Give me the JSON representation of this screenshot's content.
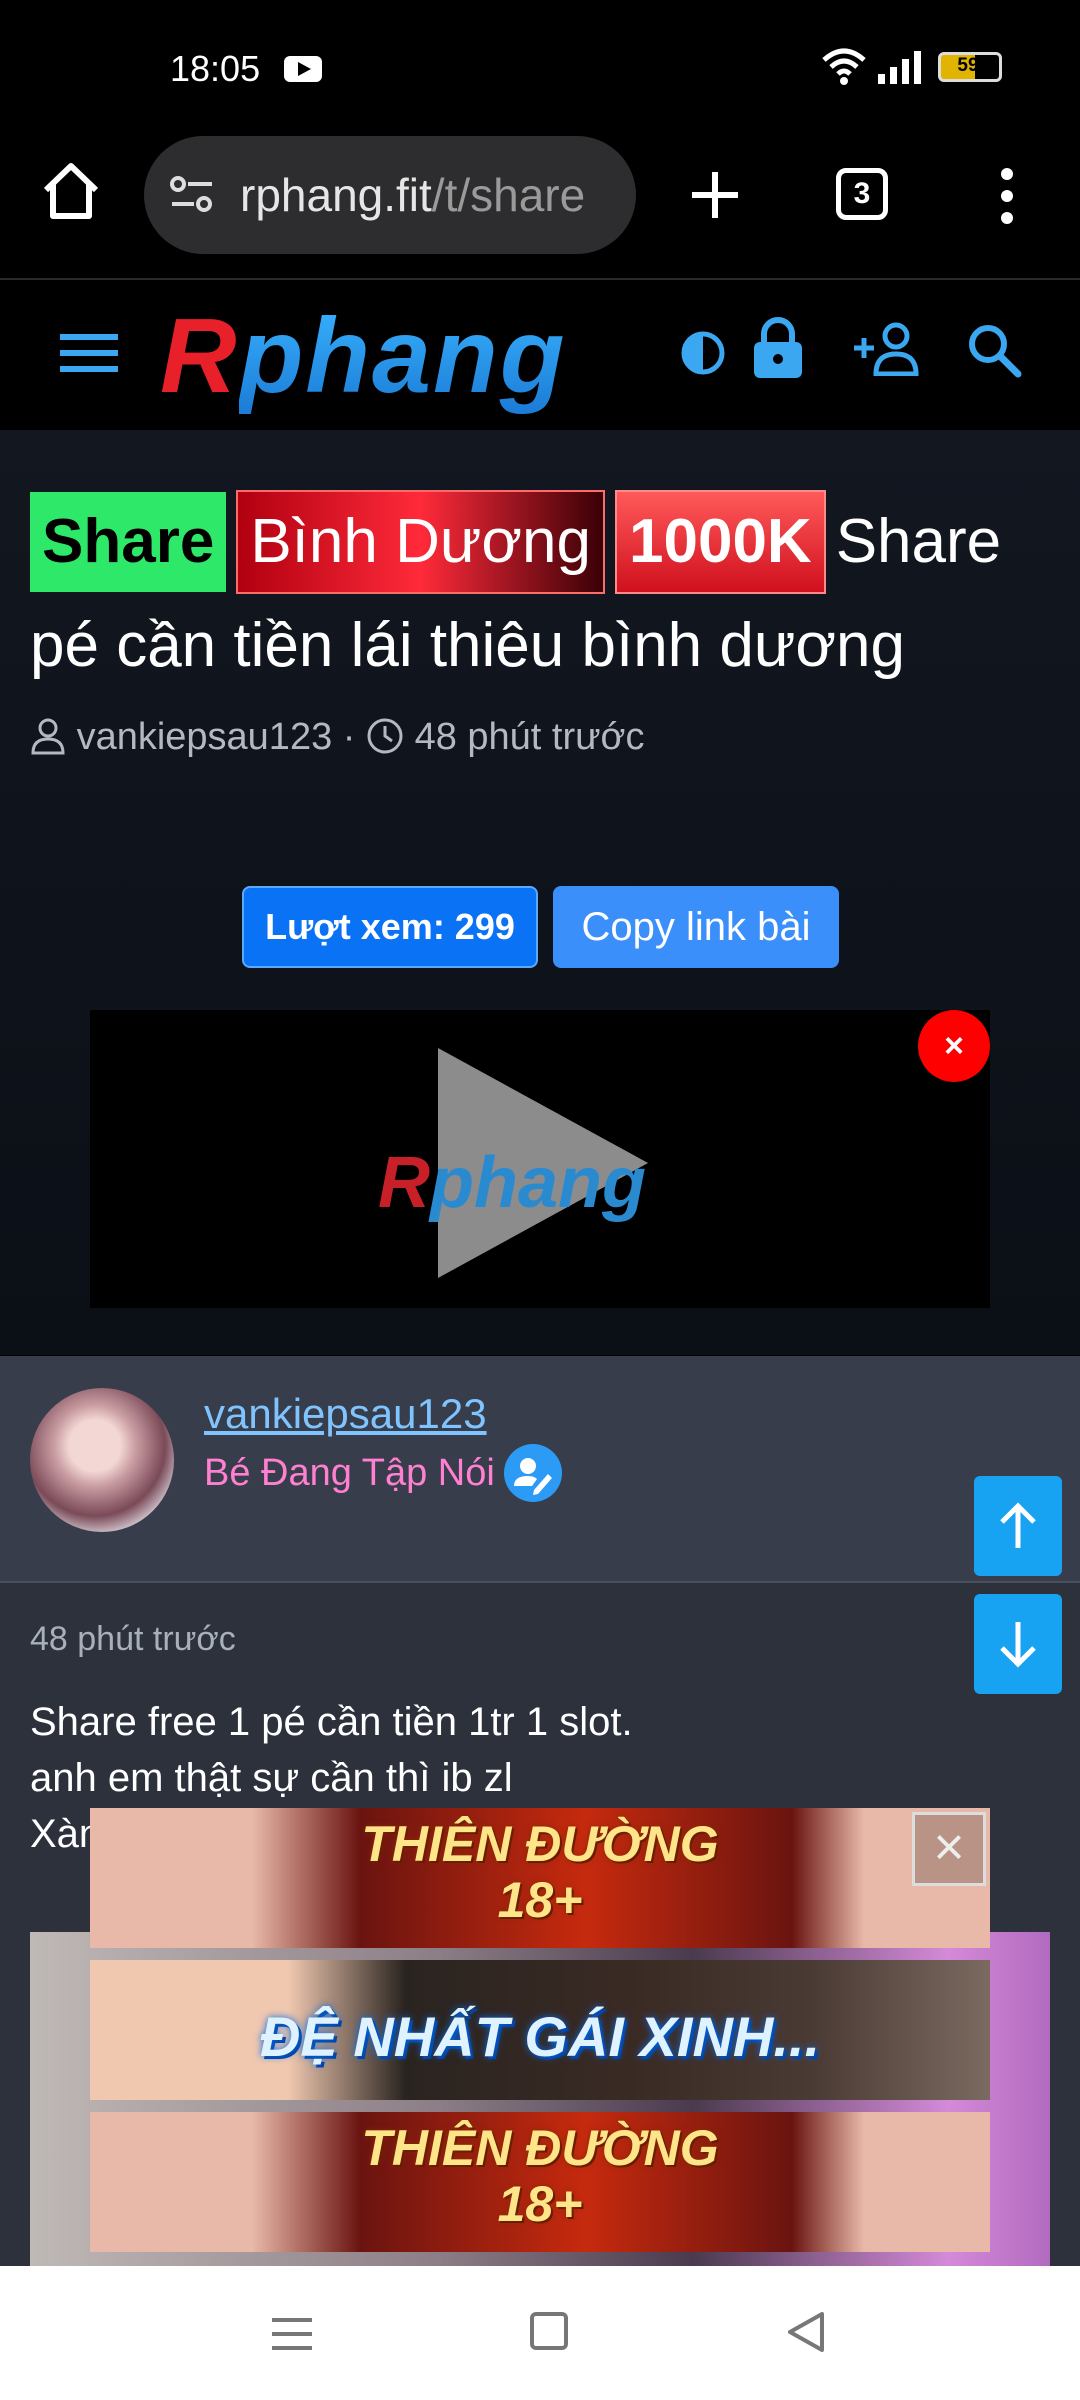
{
  "status_bar": {
    "time": "18:05",
    "battery": "59"
  },
  "browser": {
    "url_host": "rphang.fit",
    "url_path": "/t/share",
    "tab_count": "3"
  },
  "site": {
    "logo_first": "R",
    "logo_rest": "phang"
  },
  "thread": {
    "tag_share": "Share",
    "tag_location": "Bình Dương",
    "tag_price": "1000K",
    "title_text": "Share pé cần tiền lái thiêu bình dương",
    "author": "vankiepsau123",
    "time": "48 phút trước",
    "views_label": "Lượt xem: 299",
    "copy_label": "Copy link bài"
  },
  "video": {
    "logo_first": "R",
    "logo_rest": "phang",
    "close_glyph": "×"
  },
  "post": {
    "author_name": "vankiepsau123",
    "author_title": "Bé Đang Tập Nói",
    "time": "48 phút trước",
    "body_line1": "Share free 1 pé cần tiền 1tr 1 slot.",
    "body_line2": "anh em thật sự cần thì ib zl",
    "body_line3": "Xàn"
  },
  "ads": {
    "ad1_line1": "THIÊN ĐƯỜNG",
    "ad1_line2": "18+",
    "ad2_text": "ĐỆ NHẤT GÁI XINH...",
    "ad3_line1": "THIÊN ĐƯỜNG",
    "ad3_line2": "18+",
    "close_glyph": "×"
  },
  "colors": {
    "accent_blue": "#2b9bf5",
    "share_green": "#2ee86a",
    "price_red": "#d0101e",
    "author_pink": "#ff7fd1"
  }
}
